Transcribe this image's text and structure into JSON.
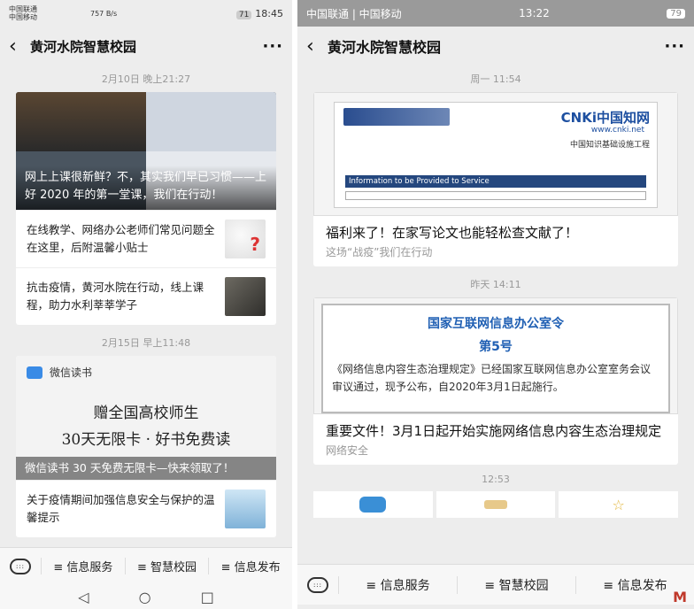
{
  "left": {
    "status": {
      "carrier1": "中国联通",
      "carrier2": "中国移动",
      "speed": "757 B/s",
      "battery": "71",
      "time": "18:45"
    },
    "header": {
      "title": "黄河水院智慧校园"
    },
    "messages": [
      {
        "time": "2月10日 晚上21:27",
        "hero_caption": "网上上课很新鲜？不，其实我们早已习惯——上好 2020 年的第一堂课，我们在行动！",
        "items": [
          "在线教学、网络办公老师们常见问题全在这里，后附温馨小贴士",
          "抗击疫情，黄河水院在行动，线上课程，助力水利莘莘学子"
        ]
      },
      {
        "time": "2月15日 早上11:48",
        "brand": "微信读书",
        "line1": "赠全国高校师生",
        "line2": "30天无限卡 · 好书免费读",
        "hero_caption": "微信读书 30 天免费无限卡—快来领取了！",
        "items": [
          "关于疫情期间加强信息安全与保护的温馨提示"
        ]
      }
    ],
    "menu": [
      "≡ 信息服务",
      "≡ 智慧校园",
      "≡ 信息发布"
    ],
    "nav": [
      "◁",
      "○",
      "□"
    ]
  },
  "right": {
    "status": {
      "carriers": "中国联通 | 中国移动",
      "time": "13:22",
      "battery": "79"
    },
    "header": {
      "title": "黄河水院智慧校园"
    },
    "messages": [
      {
        "time": "周一 11:54",
        "title": "福利来了！在家写论文也能轻松查文献了！",
        "sub": "这场“战疫”我们在行动",
        "img": {
          "cnki": "CNKi中国知网",
          "url": "www.cnki.net",
          "tag": "中国知识基础设施工程",
          "box": "Information to be Provided to Service"
        }
      },
      {
        "time": "昨天 14:11",
        "title": "重要文件！3月1日起开始实施网络信息内容生态治理规定",
        "sub": "网络安全",
        "img": {
          "h1": "国家互联网信息办公室令",
          "h2": "第5号",
          "body": "《网络信息内容生态治理规定》已经国家互联网信息办公室室务会议审议通过，现予公布，自2020年3月1日起施行。"
        }
      },
      {
        "time": "12:53"
      }
    ],
    "menu": [
      "≡ 信息服务",
      "≡ 智慧校园",
      "≡ 信息发布"
    ],
    "watermark": "M"
  }
}
